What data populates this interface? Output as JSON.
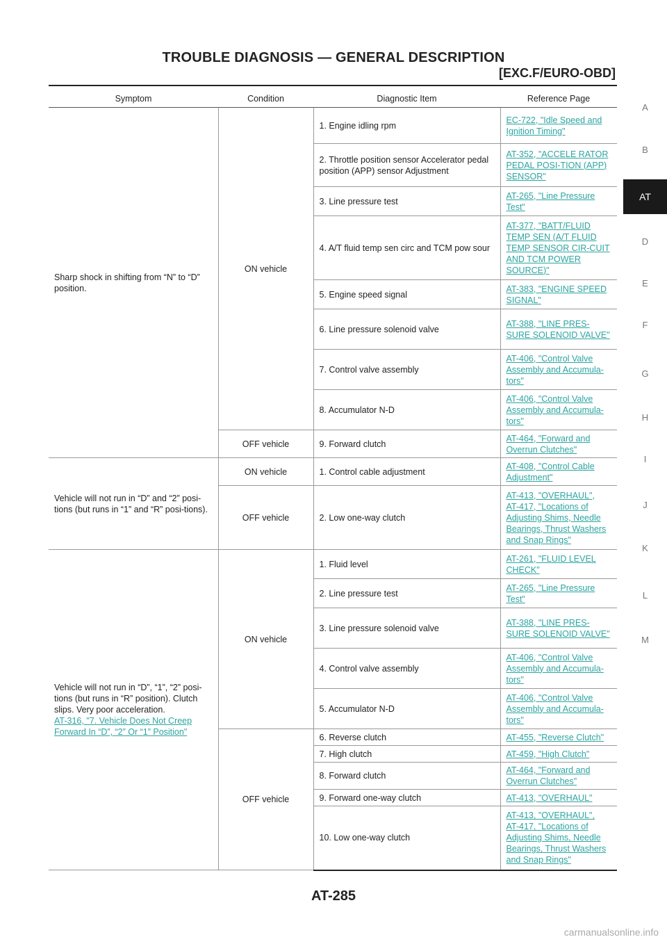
{
  "header": {
    "title": "TROUBLE DIAGNOSIS — GENERAL DESCRIPTION",
    "subtitle": "[EXC.F/EURO-OBD]"
  },
  "side_index": [
    "A",
    "B",
    "AT",
    "D",
    "E",
    "F",
    "G",
    "H",
    "I",
    "J",
    "K",
    "L",
    "M"
  ],
  "side_index_active": "AT",
  "table": {
    "headers": [
      "Symptom",
      "Condition",
      "Diagnostic Item",
      "Reference Page"
    ],
    "groups": [
      {
        "symptom": "Sharp shock in shifting from “N” to “D” position.",
        "conditions": [
          {
            "label": "ON vehicle",
            "rows": [
              {
                "item": "1. Engine idling rpm",
                "refs": [
                  "EC-722, \"Idle Speed and Ignition Timing\""
                ]
              },
              {
                "item": "2. Throttle position sensor Accelerator pedal position (APP) sensor Adjustment",
                "refs": [
                  "AT-352, \"ACCELE RATOR PEDAL POSI-TION (APP) SENSOR\""
                ]
              },
              {
                "item": "3. Line pressure test",
                "refs": [
                  "AT-265, \"Line Pressure Test\""
                ]
              },
              {
                "item": "4. A/T fluid temp sen circ and TCM pow sour",
                "refs": [
                  "AT-377, \"BATT/FLUID TEMP SEN (A/T FLUID TEMP SENSOR CIR-CUIT AND TCM POWER SOURCE)\""
                ]
              },
              {
                "item": "5. Engine speed signal",
                "refs": [
                  "AT-383, \"ENGINE SPEED SIGNAL\""
                ]
              },
              {
                "item": "6. Line pressure solenoid valve",
                "refs": [
                  "AT-388, \"LINE PRES-SURE SOLENOID VALVE\""
                ]
              },
              {
                "item": "7. Control valve assembly",
                "refs": [
                  "AT-406, \"Control Valve Assembly and Accumula-tors\""
                ]
              },
              {
                "item": "8. Accumulator N-D",
                "refs": [
                  "AT-406, \"Control Valve Assembly and Accumula-tors\""
                ]
              }
            ]
          },
          {
            "label": "OFF vehicle",
            "rows": [
              {
                "item": "9. Forward clutch",
                "refs": [
                  "AT-464, \"Forward and Overrun Clutches\""
                ]
              }
            ]
          }
        ]
      },
      {
        "symptom": "Vehicle will not run in “D” and “2” posi-tions (but runs in “1” and “R” posi-tions).",
        "conditions": [
          {
            "label": "ON vehicle",
            "rows": [
              {
                "item": "1. Control cable adjustment",
                "refs": [
                  "AT-408, \"Control Cable Adjustment\""
                ]
              }
            ]
          },
          {
            "label": "OFF vehicle",
            "rows": [
              {
                "item": "2. Low one-way clutch",
                "refs": [
                  "AT-413, \"OVERHAUL\",",
                  "AT-417, \"Locations of Adjusting Shims, Needle Bearings, Thrust Washers and Snap Rings\""
                ]
              }
            ]
          }
        ]
      },
      {
        "symptom": "Vehicle will not run in “D”, “1”, “2” posi-tions (but runs in “R” position). Clutch slips. Very poor acceleration.",
        "symptom_link": "AT-316, \"7. Vehicle Does Not Creep Forward In “D”, “2” Or “1” Position\"",
        "conditions": [
          {
            "label": "ON vehicle",
            "rows": [
              {
                "item": "1. Fluid level",
                "refs": [
                  "AT-261, \"FLUID LEVEL CHECK\""
                ]
              },
              {
                "item": "2. Line pressure test",
                "refs": [
                  "AT-265, \"Line Pressure Test\""
                ]
              },
              {
                "item": "3. Line pressure solenoid valve",
                "refs": [
                  "AT-388, \"LINE PRES-SURE SOLENOID VALVE\""
                ]
              },
              {
                "item": "4. Control valve assembly",
                "refs": [
                  "AT-406, \"Control Valve Assembly and Accumula-tors\""
                ]
              },
              {
                "item": "5. Accumulator N-D",
                "refs": [
                  "AT-406, \"Control Valve Assembly and Accumula-tors\""
                ]
              }
            ]
          },
          {
            "label": "OFF vehicle",
            "rows": [
              {
                "item": "6. Reverse clutch",
                "refs": [
                  "AT-455, \"Reverse Clutch\""
                ]
              },
              {
                "item": "7. High clutch",
                "refs": [
                  "AT-459, \"High Clutch\""
                ]
              },
              {
                "item": "8. Forward clutch",
                "refs": [
                  "AT-464, \"Forward and Overrun Clutches\""
                ]
              },
              {
                "item": "9. Forward one-way clutch",
                "refs": [
                  "AT-413, \"OVERHAUL\""
                ]
              },
              {
                "item": "10. Low one-way clutch",
                "refs": [
                  "AT-413, \"OVERHAUL\",",
                  "AT-417, \"Locations of Adjusting Shims, Needle Bearings, Thrust Washers and Snap Rings\""
                ]
              }
            ]
          }
        ]
      }
    ]
  },
  "footer": {
    "page_number": "AT-285"
  },
  "watermark": "carmanualsonline.info"
}
